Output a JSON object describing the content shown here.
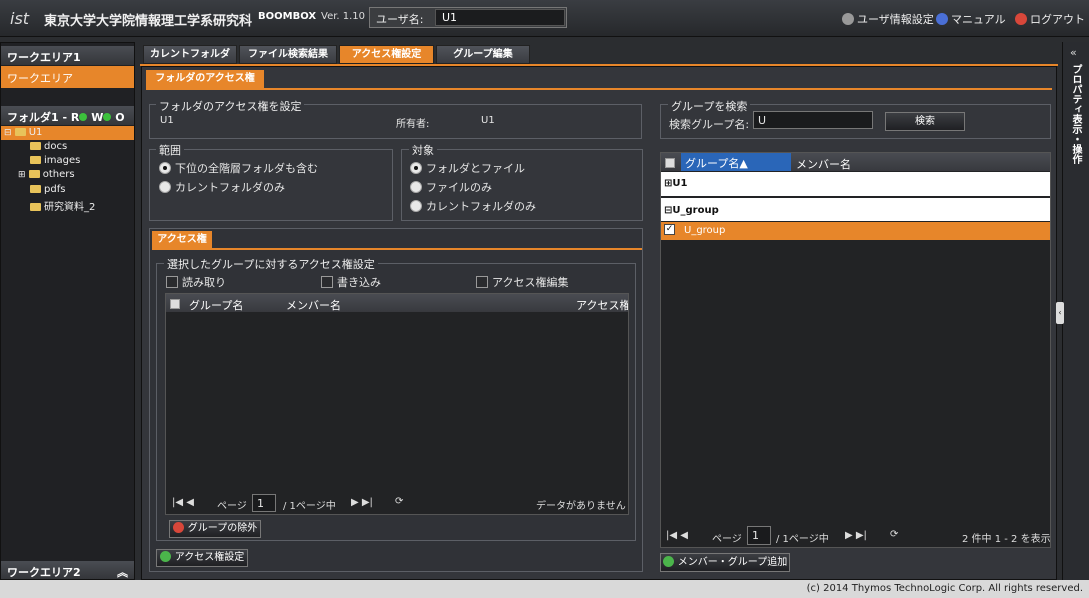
{
  "header": {
    "logo": "ist",
    "univ": "東京大学大学院情報理工学系研究科",
    "app": "BOOMBOX",
    "version": "Ver. 1.10",
    "user_label": "ユーザ名:",
    "user_value": "U1",
    "settings": "ユーザ情報設定",
    "manual": "マニュアル",
    "logout": "ログアウト"
  },
  "left": {
    "workarea1": "ワークエリア1",
    "workarea_item": "ワークエリア",
    "folder_header": "フォルダ1 - R",
    "perm_w": "W",
    "perm_o": "O",
    "workarea2": "ワークエリア2",
    "tree": [
      "U1",
      "docs",
      "images",
      "others",
      "pdfs",
      "研究資料_2"
    ]
  },
  "tabs": [
    "カレントフォルダ",
    "ファイル検索結果",
    "アクセス権設定",
    "グループ編集"
  ],
  "subtab": "フォルダのアクセス権",
  "access": {
    "section_title": "フォルダのアクセス権を設定",
    "folder": "U1",
    "owner_label": "所有者:",
    "owner": "U1",
    "scope_title": "範囲",
    "scope_opts": [
      "下位の全階層フォルダも含む",
      "カレントフォルダのみ"
    ],
    "target_title": "対象",
    "target_opts": [
      "フォルダとファイル",
      "ファイルのみ",
      "カレントフォルダのみ"
    ],
    "perm_tab": "アクセス権",
    "perm_title": "選択したグループに対するアクセス権設定",
    "perms": [
      "読み取り",
      "書き込み",
      "アクセス権編集"
    ],
    "cols": [
      "グループ名",
      "メンバー名",
      "アクセス権"
    ],
    "page_label": "ページ",
    "page_value": "1",
    "page_of": "/ 1ページ中",
    "empty": "データがありません",
    "remove_btn": "グループの除外",
    "set_btn": "アクセス権設定"
  },
  "group": {
    "section_title": "グループを検索",
    "search_label": "検索グループ名:",
    "search_value": "U",
    "search_btn": "検索",
    "cols": [
      "グループ名▲",
      "メンバー名"
    ],
    "rows": [
      "U1",
      "U_group"
    ],
    "selected": "U_group",
    "page_label": "ページ",
    "page_value": "1",
    "page_of": "/ 1ページ中",
    "count": "2 件中 1 - 2 を表示",
    "add_btn": "メンバー・グループ追加"
  },
  "rightbar": "プロパティ表示・操作",
  "footer": "(c) 2014 Thymos TechnoLogic Corp. All rights reserved."
}
